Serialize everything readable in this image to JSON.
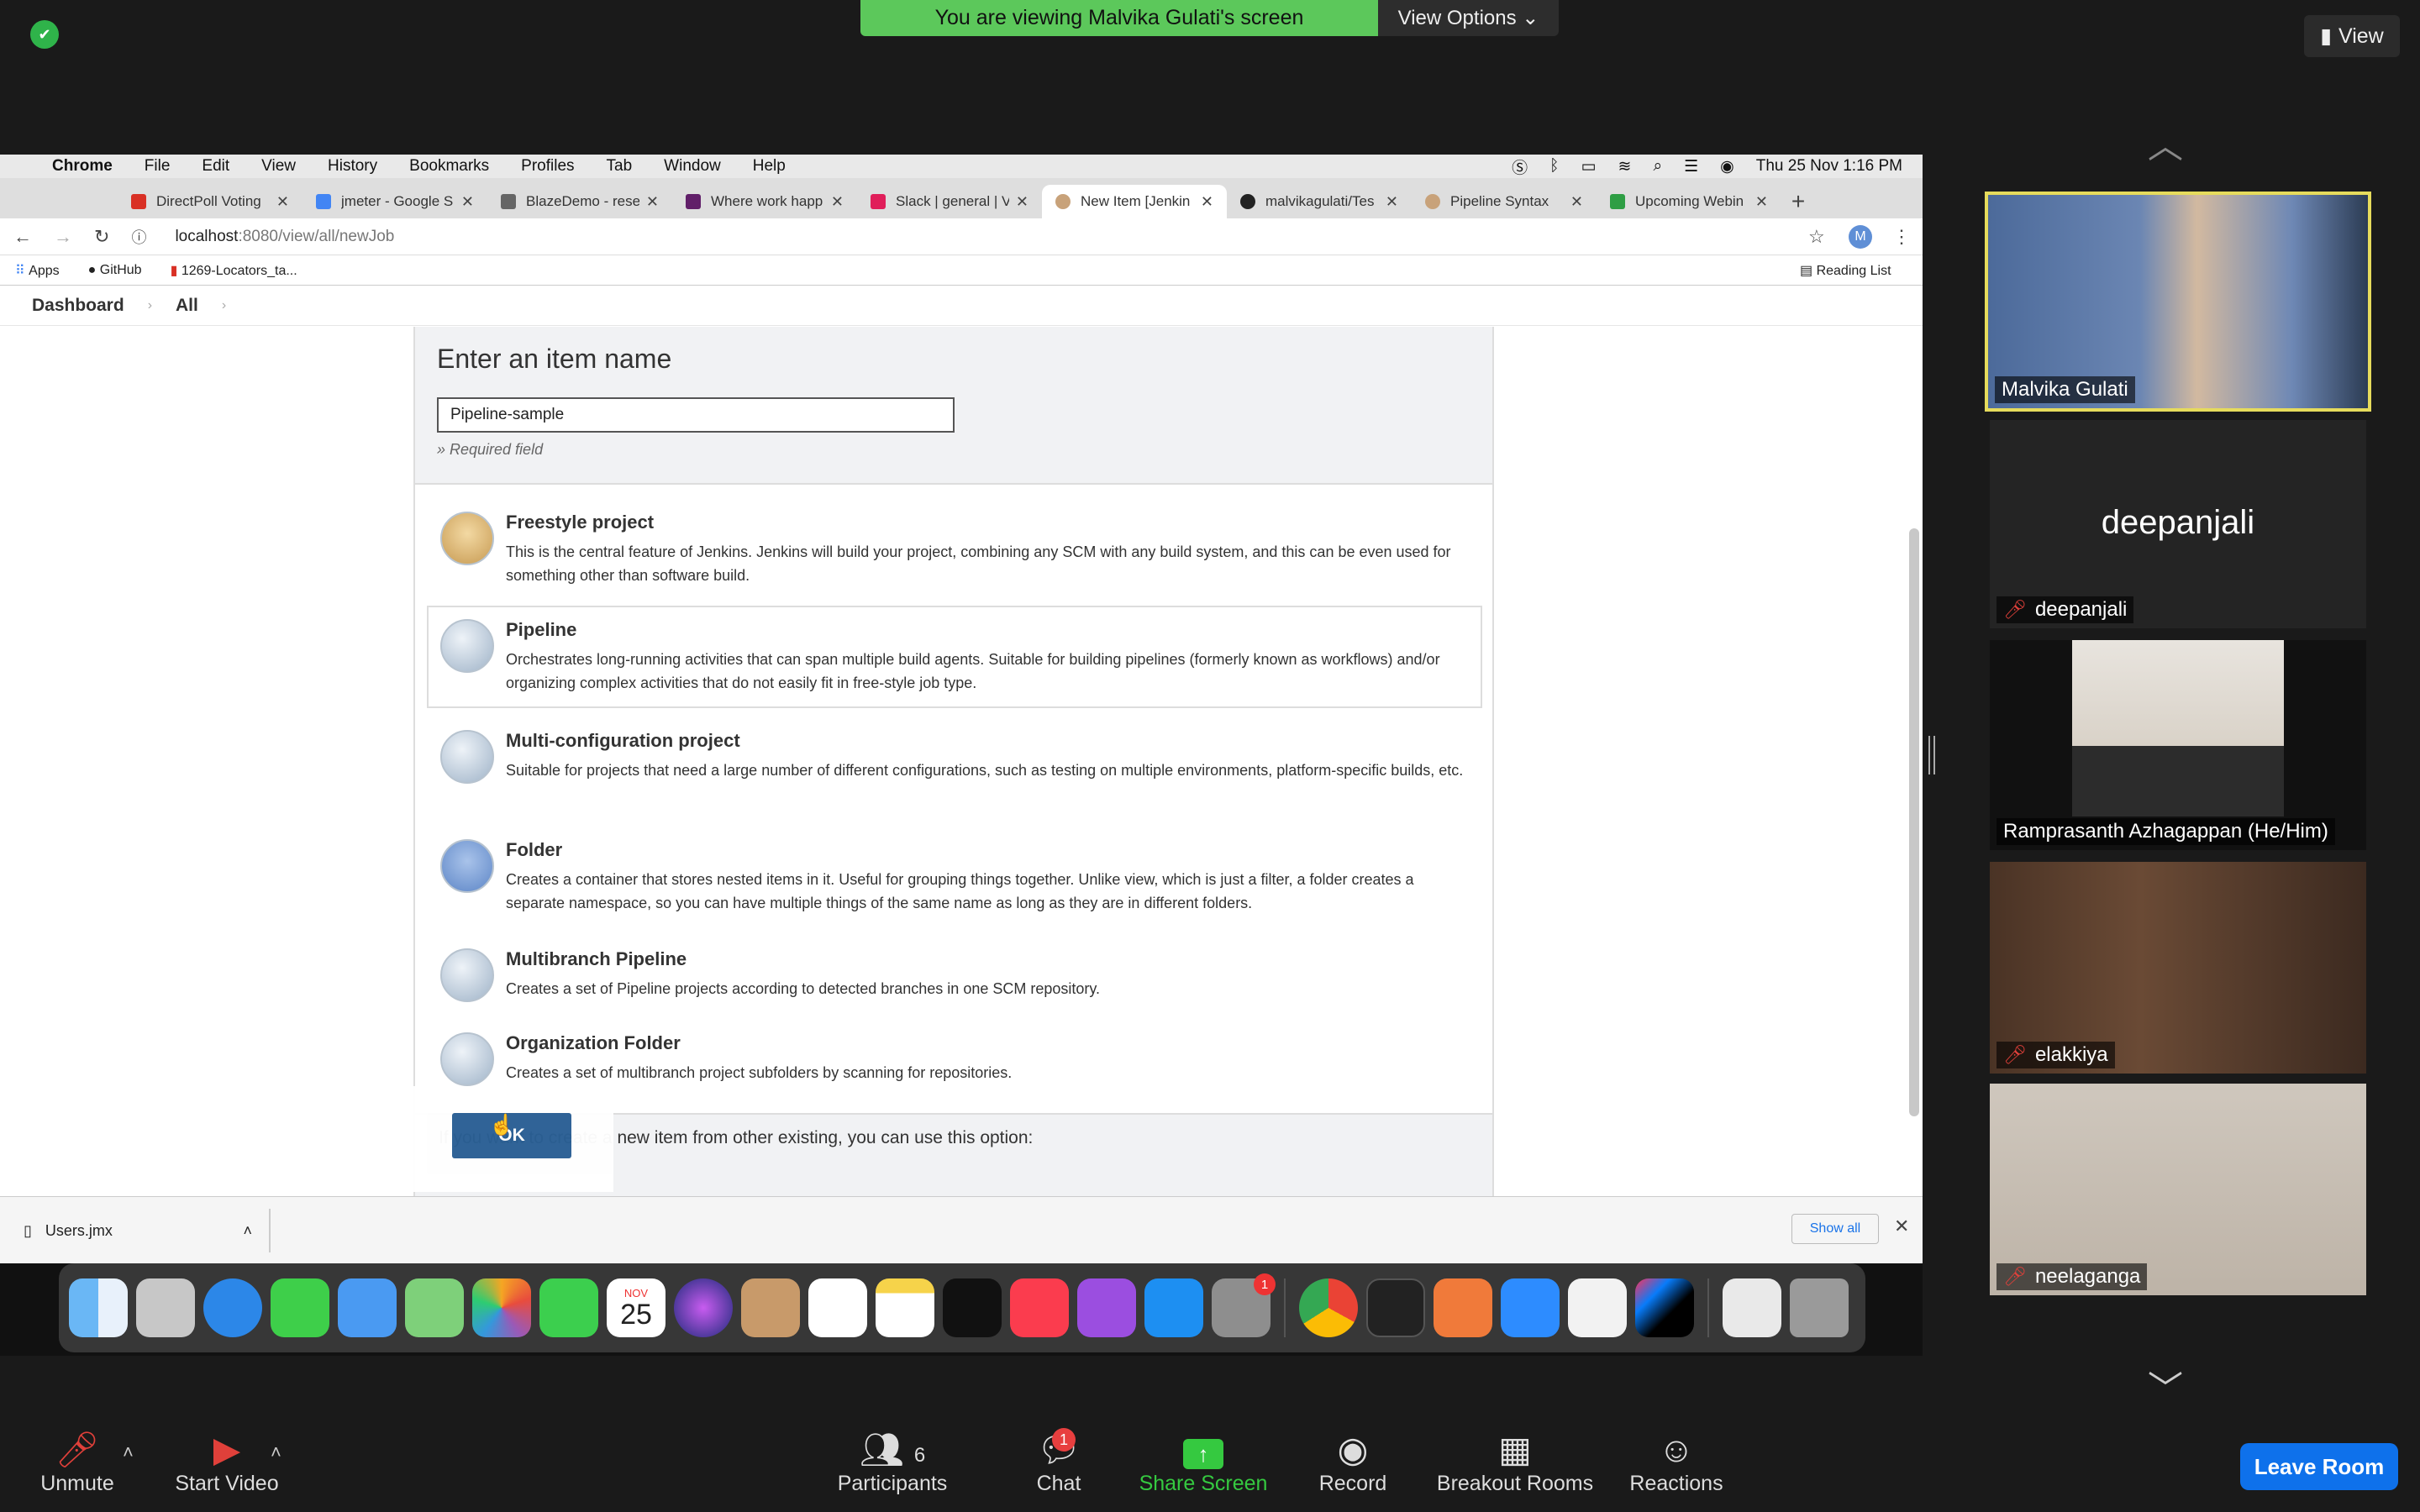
{
  "zoom": {
    "share_banner": "You are viewing Malvika Gulati's screen",
    "view_options": "View Options ⌄",
    "view_button": "View",
    "toolbar": {
      "unmute": "Unmute",
      "start_video": "Start Video",
      "participants": "Participants",
      "participants_count": "6",
      "chat": "Chat",
      "chat_badge": "1",
      "share_screen": "Share Screen",
      "record": "Record",
      "breakout_rooms": "Breakout Rooms",
      "reactions": "Reactions",
      "leave": "Leave Room"
    },
    "participants": [
      {
        "name": "Malvika Gulati",
        "muted": false
      },
      {
        "name": "deepanjali",
        "muted": true,
        "label": "deepanjali"
      },
      {
        "name": "Ramprasanth Azhagappan (He/Him)",
        "muted": false
      },
      {
        "name": "elakkiya",
        "muted": true
      },
      {
        "name": "neelaganga",
        "muted": true
      }
    ]
  },
  "mac": {
    "menubar": {
      "app": "Chrome",
      "items": [
        "File",
        "Edit",
        "View",
        "History",
        "Bookmarks",
        "Profiles",
        "Tab",
        "Window",
        "Help"
      ],
      "clock": "Thu 25 Nov  1:16 PM"
    }
  },
  "chrome": {
    "tabs": [
      {
        "label": "DirectPoll Voting",
        "color": "#d93025"
      },
      {
        "label": "jmeter - Google S",
        "color": "#4285f4"
      },
      {
        "label": "BlazeDemo - rese",
        "color": "#666666"
      },
      {
        "label": "Where work happ",
        "color": "#611f69"
      },
      {
        "label": "Slack | general | V",
        "color": "#e01e5a"
      },
      {
        "label": "New Item [Jenkin",
        "color": "#c8a27a"
      },
      {
        "label": "malvikagulati/Tes",
        "color": "#222222"
      },
      {
        "label": "Pipeline Syntax",
        "color": "#c8a27a"
      },
      {
        "label": "Upcoming Webin",
        "color": "#2e9e44"
      }
    ],
    "url_host": "localhost",
    "url_path": ":8080/view/all/newJob",
    "profile_initial": "M",
    "bookmarks": [
      "Apps",
      "GitHub",
      "1269-Locators_ta..."
    ],
    "reading_list": "Reading List",
    "download_file": "Users.jmx",
    "show_all": "Show all"
  },
  "jenkins": {
    "breadcrumb": [
      "Dashboard",
      "All"
    ],
    "title": "Enter an item name",
    "item_name": "Pipeline-sample",
    "required": "» Required field",
    "types": [
      {
        "name": "Freestyle project",
        "desc": "This is the central feature of Jenkins. Jenkins will build your project, combining any SCM with any build system, and this can be even used for something other than software build."
      },
      {
        "name": "Pipeline",
        "desc": "Orchestrates long-running activities that can span multiple build agents. Suitable for building pipelines (formerly known as workflows) and/or organizing complex activities that do not easily fit in free-style job type."
      },
      {
        "name": "Multi-configuration project",
        "desc": "Suitable for projects that need a large number of different configurations, such as testing on multiple environments, platform-specific builds, etc."
      },
      {
        "name": "Folder",
        "desc": "Creates a container that stores nested items in it. Useful for grouping things together. Unlike view, which is just a filter, a folder creates a separate namespace, so you can have multiple things of the same name as long as they are in different folders."
      },
      {
        "name": "Multibranch Pipeline",
        "desc": "Creates a set of Pipeline projects according to detected branches in one SCM repository."
      },
      {
        "name": "Organization Folder",
        "desc": "Creates a set of multibranch project subfolders by scanning for repositories."
      }
    ],
    "selected": "Pipeline",
    "ok": "OK",
    "copy_text": "If you want to create a new item from other existing, you can use this option:"
  },
  "dock": {
    "calendar_month": "NOV",
    "calendar_day": "25",
    "settings_badge": "1"
  }
}
